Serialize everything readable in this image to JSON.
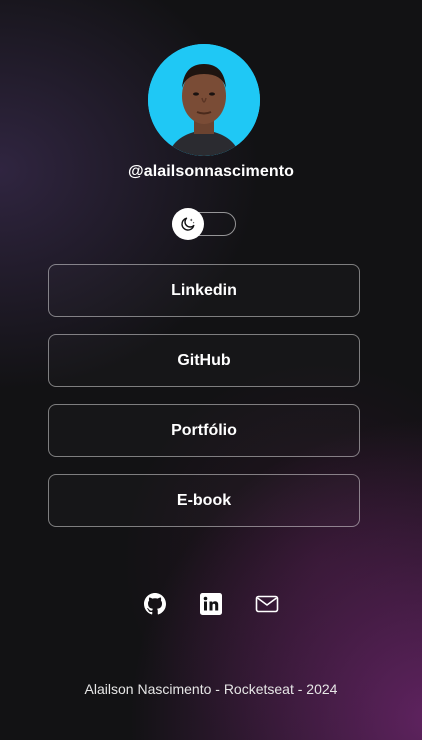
{
  "profile": {
    "username": "@alailsonnascimento",
    "avatar_background": "#1fc8f5"
  },
  "theme_toggle": {
    "icon": "moon-stars-icon",
    "state": "dark"
  },
  "links": [
    {
      "label": "Linkedin"
    },
    {
      "label": "GitHub"
    },
    {
      "label": "Portfólio"
    },
    {
      "label": "E-book"
    }
  ],
  "social": [
    {
      "icon": "github-icon"
    },
    {
      "icon": "linkedin-icon"
    },
    {
      "icon": "mail-icon"
    }
  ],
  "footer": {
    "text": "Alailson Nascimento - Rocketseat - 2024"
  },
  "colors": {
    "background": "#121214",
    "accent_gradient": "#782878",
    "text": "#ffffff"
  }
}
